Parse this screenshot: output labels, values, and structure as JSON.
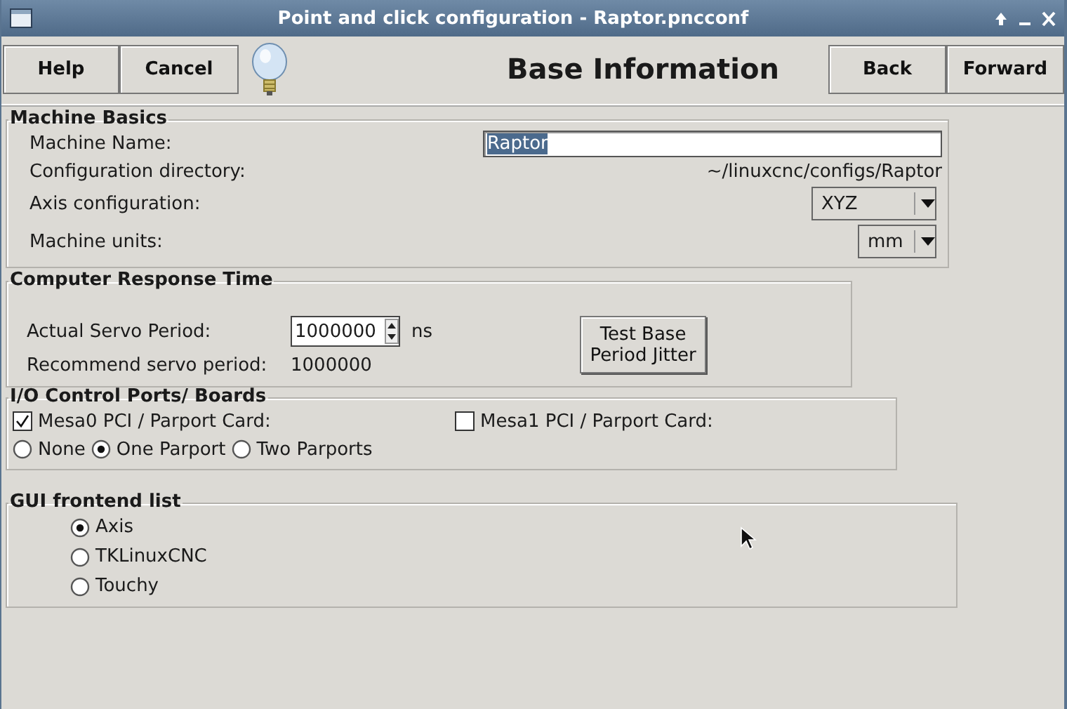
{
  "window": {
    "title": "Point and click configuration - Raptor.pncconf"
  },
  "toolbar": {
    "left_buttons": [
      "Help",
      "Cancel"
    ],
    "page_title": "Base Information",
    "right_buttons": [
      "Back",
      "Forward"
    ]
  },
  "machine_basics": {
    "title": "Machine Basics",
    "rows": [
      {
        "kind": "entry",
        "label": "Machine Name:",
        "value": "Raptor",
        "text_selected": true
      },
      {
        "kind": "text",
        "label": "Configuration directory:",
        "value": "~/linuxcnc/configs/Raptor"
      },
      {
        "kind": "combo",
        "label": "Axis configuration:",
        "value": "XYZ"
      },
      {
        "kind": "combo",
        "label": "Machine units:",
        "value": "mm"
      }
    ]
  },
  "response_time": {
    "title": "Computer Response Time",
    "servo_label": "Actual Servo Period:",
    "servo_value": "1000000",
    "unit": "ns",
    "recommend_label": "Recommend servo period:",
    "recommend_value": "1000000",
    "test_button": "Test Base Period Jitter"
  },
  "io_ports": {
    "title": "I/O Control Ports/ Boards",
    "cards": [
      {
        "label": "Mesa0 PCI / Parport Card:",
        "checked": true
      },
      {
        "label": "Mesa1 PCI / Parport Card:",
        "checked": false
      }
    ],
    "parports": [
      {
        "label": "None",
        "selected": false
      },
      {
        "label": "One Parport",
        "selected": true
      },
      {
        "label": "Two Parports",
        "selected": false
      }
    ]
  },
  "gui_frontends": {
    "title": "GUI frontend list",
    "options": [
      {
        "label": "Axis",
        "selected": true
      },
      {
        "label": "TKLinuxCNC",
        "selected": false
      },
      {
        "label": "Touchy",
        "selected": false
      }
    ]
  }
}
